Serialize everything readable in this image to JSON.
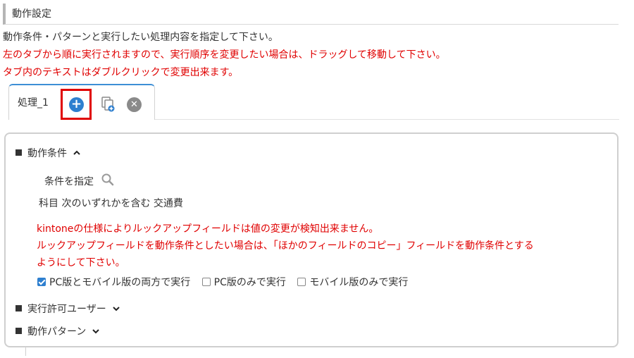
{
  "header": {
    "title": "動作設定"
  },
  "description": {
    "line1": "動作条件・パターンと実行したい処理内容を指定して下さい。",
    "line2": "左のタブから順に実行されますので、実行順序を変更したい場合は、ドラッグして移動して下さい。",
    "line3": "タブ内のテキストはダブルクリックで変更出来ます。"
  },
  "tabs": [
    {
      "label": "処理_1",
      "icons": [
        "add-icon",
        "copy-icon",
        "close-icon"
      ]
    }
  ],
  "icons": {
    "add": "+",
    "close": "✕"
  },
  "panel": {
    "conditions": {
      "heading": "動作条件",
      "specify_label": "条件を指定",
      "condition_text": "科目 次のいずれかを含む 交通費",
      "warning_line1": "kintoneの仕様によりルックアップフィールドは値の変更が検知出来ません。",
      "warning_line2": "ルックアップフィールドを動作条件としたい場合は、「ほかのフィールドのコピー」フィールドを動作条件とする",
      "warning_line3": "ようにして下さい。"
    },
    "run_options": [
      {
        "label": "PC版とモバイル版の両方で実行",
        "checked": true
      },
      {
        "label": "PC版のみで実行",
        "checked": false
      },
      {
        "label": "モバイル版のみで実行",
        "checked": false
      }
    ],
    "permitted_users": {
      "heading": "実行許可ユーザー"
    },
    "patterns": {
      "heading": "動作パターン"
    }
  },
  "colors": {
    "accent": "#2e7fcf",
    "warning": "#e00000",
    "highlight": "#e00000"
  }
}
